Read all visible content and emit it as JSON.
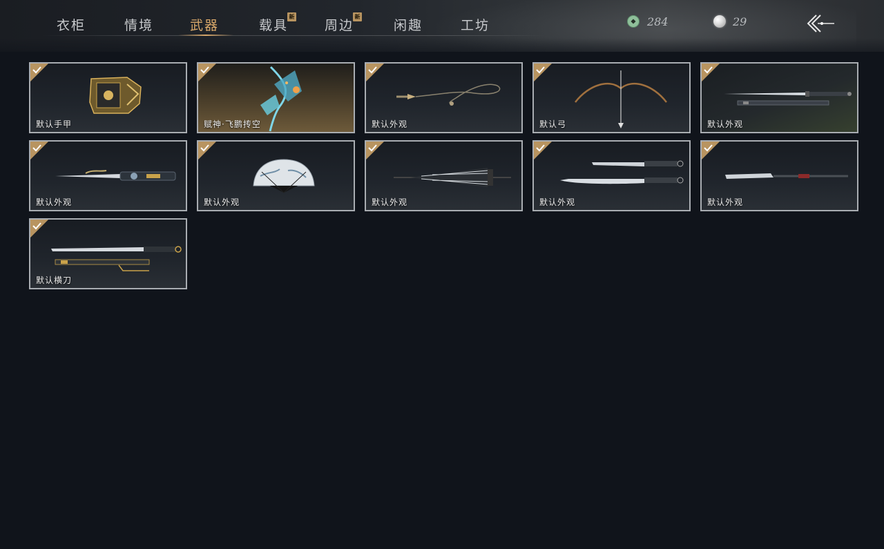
{
  "tabs": [
    {
      "label": "衣柜",
      "active": false,
      "new": false
    },
    {
      "label": "情境",
      "active": false,
      "new": false
    },
    {
      "label": "武器",
      "active": true,
      "new": false
    },
    {
      "label": "载具",
      "active": false,
      "new": true
    },
    {
      "label": "周边",
      "active": false,
      "new": true
    },
    {
      "label": "闲趣",
      "active": false,
      "new": false
    },
    {
      "label": "工坊",
      "active": false,
      "new": false
    }
  ],
  "new_badge": "新",
  "currencies": [
    {
      "icon": "jade-coin-icon",
      "value": "284"
    },
    {
      "icon": "pearl-icon",
      "value": "29"
    }
  ],
  "colors": {
    "active_tab": "#d8a86a",
    "card_border": "#a9adb2",
    "check_badge": "#b89460",
    "background": "#10141b"
  },
  "items": [
    {
      "label": "默认手甲",
      "icon": "gauntlet-icon",
      "owned": true
    },
    {
      "label": "赋神·飞鹏抟空",
      "icon": "winged-spirit-icon",
      "owned": true
    },
    {
      "label": "默认外观",
      "icon": "rope-dart-icon",
      "owned": true
    },
    {
      "label": "默认弓",
      "icon": "bow-icon",
      "owned": true
    },
    {
      "label": "默认外观",
      "icon": "sword-and-scabbard-icon",
      "owned": true
    },
    {
      "label": "默认外观",
      "icon": "ornate-sword-icon",
      "owned": true
    },
    {
      "label": "默认外观",
      "icon": "folding-fan-icon",
      "owned": true
    },
    {
      "label": "默认外观",
      "icon": "umbrella-icon",
      "owned": true
    },
    {
      "label": "默认外观",
      "icon": "twin-sabers-icon",
      "owned": true
    },
    {
      "label": "默认外观",
      "icon": "glaive-icon",
      "owned": true
    },
    {
      "label": "默认横刀",
      "icon": "hengdao-blade-icon",
      "owned": true
    }
  ]
}
